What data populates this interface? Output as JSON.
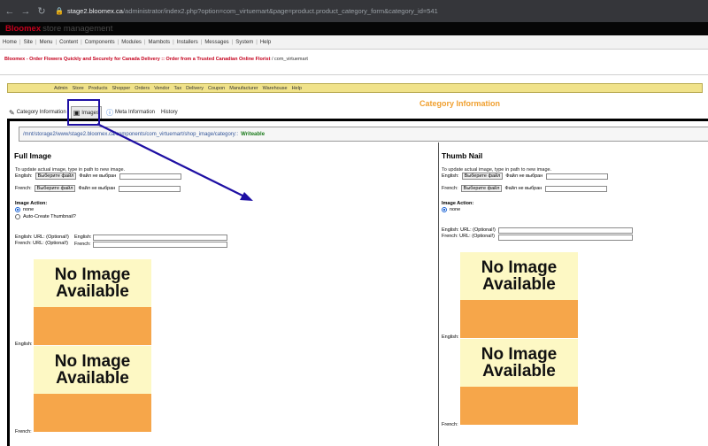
{
  "browser": {
    "url_host": "stage2.bloomex.ca",
    "url_path": "/administrator/index2.php?option=com_virtuemart&page=product.product_category_form&category_id=541"
  },
  "header": {
    "brand": "Bloomex",
    "subtitle": "store management"
  },
  "top_menu": [
    "Home",
    "Site",
    "Menu",
    "Content",
    "Components",
    "Modules",
    "Mambots",
    "Installers",
    "Messages",
    "System",
    "Help"
  ],
  "pathway": {
    "link": "Bloomex - Order Flowers Quickly and Securely for Canada Delivery :: Order from a Trusted Canadian Online Florist",
    "tail": " / com_virtuemart"
  },
  "vm_menu": [
    "Admin",
    "Store",
    "Products",
    "Shopper",
    "Orders",
    "Vendor",
    "Tax",
    "Delivery",
    "Coupon",
    "Manufacturer",
    "Warehouse",
    "Help"
  ],
  "page_title": "Category Information",
  "tabs": [
    {
      "label": "Category Information",
      "icon": "edit-icon"
    },
    {
      "label": "Images",
      "icon": "image-icon"
    },
    {
      "label": "Meta Information",
      "icon": "info-icon"
    },
    {
      "label": "History",
      "icon": ""
    }
  ],
  "directory": {
    "path": "/mnt/storage2/www/stage2.bloomex.ca/components/com_virtuemart/shop_image/category",
    "separator": " :: ",
    "status": "Writeable"
  },
  "full_image": {
    "title": "Full Image",
    "note": "To update actual image, type in path to new image.",
    "english_label": "English:",
    "french_label": "French:",
    "browse_label": "Выберите файл",
    "no_file": "Файл не выбран",
    "action_label": "Image Action:",
    "option_none": "none",
    "option_auto": "Auto-Create Thumbnail?",
    "url_label_en": "English: URL: (Optional!)",
    "url_label_fr": "French: URL: (Optional!)",
    "url_field_en": "English:",
    "url_field_fr": "French:",
    "img_label_en": "English:",
    "img_label_fr": "French:"
  },
  "thumb_image": {
    "title": "Thumb Nail",
    "note": "To update actual image, type in path to new image.",
    "english_label": "English:",
    "french_label": "French:",
    "browse_label": "Выберите файл",
    "no_file": "Файл не выбран",
    "action_label": "Image Action:",
    "option_none": "none",
    "url_label_en": "English: URL: (Optional!)",
    "url_label_fr": "French: URL: (Optional!)",
    "img_label_en": "English:",
    "img_label_fr": "French:"
  },
  "placeholder_image": {
    "line1": "No Image",
    "line2": "Available"
  },
  "colors": {
    "annotation": "#1e0fa3",
    "brand": "#c4001d",
    "title": "#f0a030",
    "toolbar": "#f0e28a",
    "placeholder_top": "#fdf8c4",
    "placeholder_bottom": "#f6a64a"
  }
}
